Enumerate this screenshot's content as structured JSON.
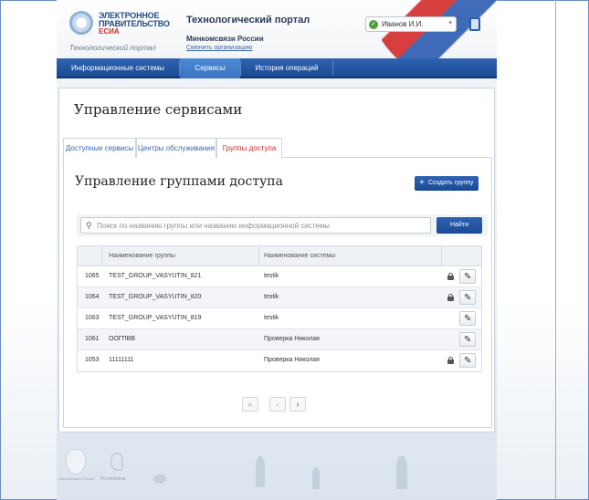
{
  "header": {
    "logo_line1": "ЭЛЕКТРОННОЕ",
    "logo_line2": "ПРАВИТЕЛЬСТВО",
    "logo_line3": "ЕСИА",
    "logo_caption": "Технологический портал",
    "portal_title": "Технологический портал",
    "ministry": "Минкомсвязи России",
    "change_org": "Сменить организацию",
    "user_name": "Иванов И.И."
  },
  "nav": {
    "items": [
      {
        "label": "Информационные системы"
      },
      {
        "label": "Сервисы"
      },
      {
        "label": "История операций"
      }
    ]
  },
  "page": {
    "title": "Управление сервисами",
    "tabs": [
      {
        "label": "Доступные сервисы"
      },
      {
        "label": "Центры обслуживания"
      },
      {
        "label": "Группы доступа"
      }
    ],
    "subtitle": "Управление группами доступа",
    "create_button": "Создать группу",
    "search_placeholder": "Поиск по названию группы или названию информационной системы",
    "search_button": "Найти"
  },
  "table": {
    "headers": [
      "Наименование группы",
      "Наименование системы"
    ],
    "rows": [
      {
        "id": "1065",
        "name": "TEST_GROUP_VASYUTIN_821",
        "system": "testik",
        "locked": true
      },
      {
        "id": "1064",
        "name": "TEST_GROUP_VASYUTIN_820",
        "system": "testik",
        "locked": true
      },
      {
        "id": "1063",
        "name": "TEST_GROUP_VASYUTIN_819",
        "system": "testik",
        "locked": false
      },
      {
        "id": "1061",
        "name": "ООГПВВ",
        "system": "Проверка Николая",
        "locked": false
      },
      {
        "id": "1053",
        "name": "11111111",
        "system": "Проверка Николая",
        "locked": true
      }
    ]
  },
  "pager": {
    "first": "«",
    "prev": "‹",
    "next": "›"
  },
  "footer": {
    "emblem_caption": "Минкомсвязь России",
    "ear_caption": "Ростелеком"
  },
  "colors": {
    "nav_blue": "#1a4a93",
    "accent_red": "#cc2a2a",
    "link_blue": "#3a67b0"
  }
}
